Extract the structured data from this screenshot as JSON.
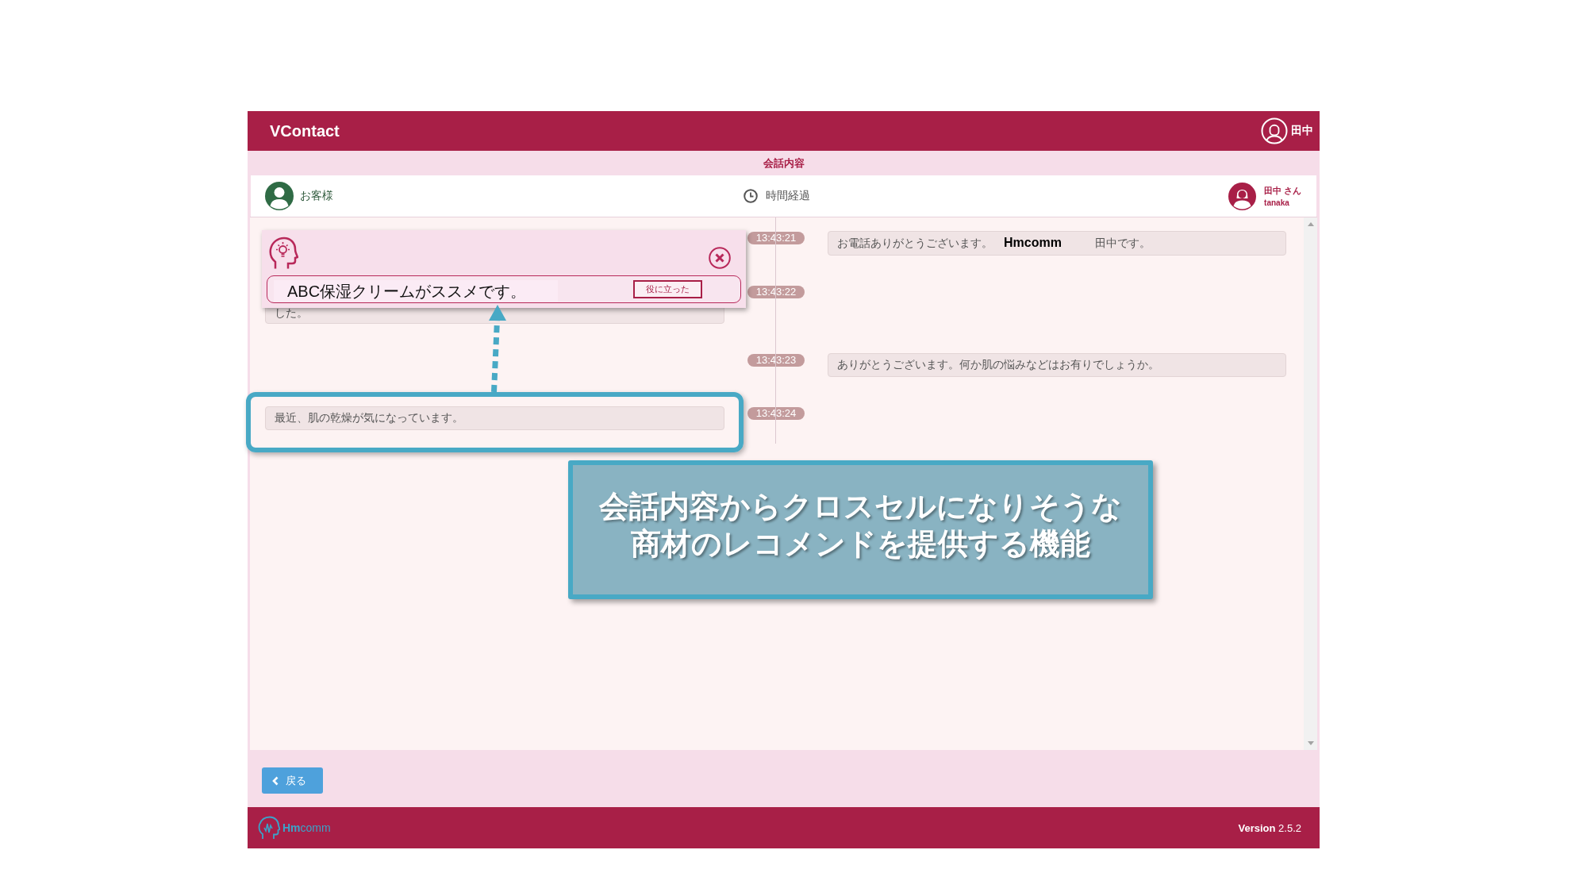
{
  "app_header": {
    "title": "VContact",
    "user_name": "田中"
  },
  "section_title": "会話内容",
  "participants": {
    "customer": "お客様",
    "elapsed": "時間経過",
    "operator_name": "田中 さん",
    "operator_id": "tanaka"
  },
  "messages": [
    {
      "time": "13:43:21",
      "kind": "operator",
      "covered": false,
      "text": "お電話ありがとうございます。　**Hmcomm**　　　田中です。"
    },
    {
      "time": "13:43:22",
      "kind": "customer",
      "covered": true,
      "text": "した。"
    },
    {
      "time": "13:43:23",
      "kind": "operator",
      "covered": false,
      "text": "ありがとうございます。何か肌の悩みなどはお有りでしょうか。"
    },
    {
      "time": "13:43:24",
      "kind": "customer",
      "covered": false,
      "text": "最近、肌の乾燥が気になっています。"
    }
  ],
  "recommendation_popup": {
    "text": "ABC保湿クリームがススメです。",
    "feedback_button": "役に立った"
  },
  "annotation": {
    "callout": "会話内容からクロスセルになりそうな商材のレコメンドを提供する機能"
  },
  "footer": {
    "back_button": "戻る"
  },
  "bottom_bar": {
    "logo": "**Hm**comm",
    "version": "**Version** 2.5.2"
  }
}
